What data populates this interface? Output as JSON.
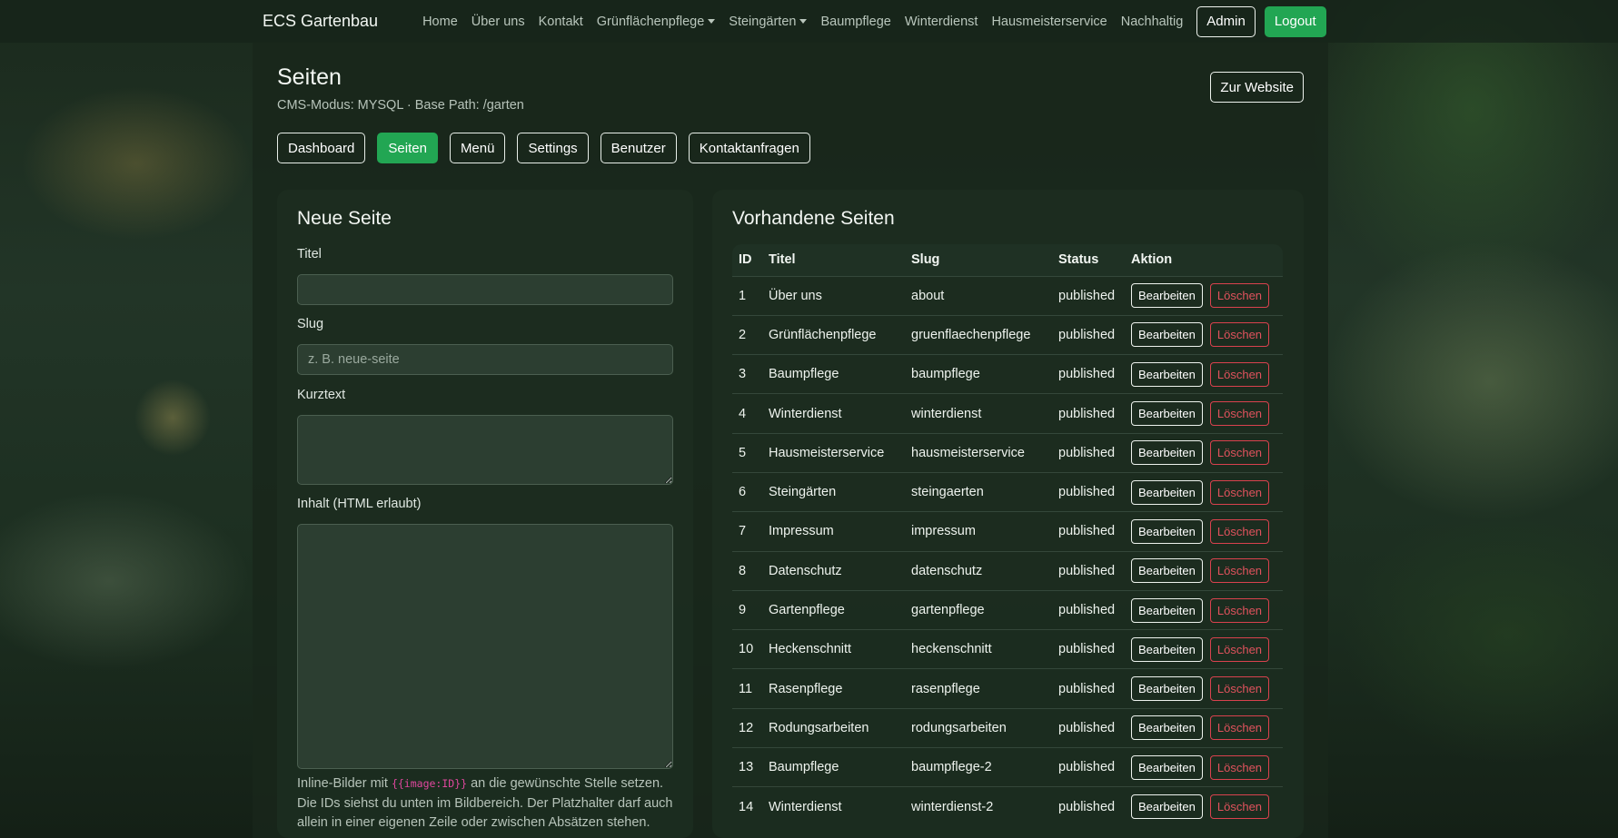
{
  "nav": {
    "brand": "ECS Gartenbau",
    "links": [
      {
        "label": "Home",
        "dropdown": false
      },
      {
        "label": "Über uns",
        "dropdown": false
      },
      {
        "label": "Kontakt",
        "dropdown": false
      },
      {
        "label": "Grünflächenpflege",
        "dropdown": true
      },
      {
        "label": "Steingärten",
        "dropdown": true
      },
      {
        "label": "Baumpflege",
        "dropdown": false
      },
      {
        "label": "Winterdienst",
        "dropdown": false
      },
      {
        "label": "Hausmeisterservice",
        "dropdown": false
      },
      {
        "label": "Nachhaltig",
        "dropdown": false
      }
    ],
    "admin_label": "Admin",
    "logout_label": "Logout"
  },
  "header": {
    "title": "Seiten",
    "subtitle": "CMS-Modus: MYSQL · Base Path: /garten",
    "to_site_label": "Zur Website"
  },
  "tabs": [
    {
      "label": "Dashboard",
      "active": false
    },
    {
      "label": "Seiten",
      "active": true
    },
    {
      "label": "Menü",
      "active": false
    },
    {
      "label": "Settings",
      "active": false
    },
    {
      "label": "Benutzer",
      "active": false
    },
    {
      "label": "Kontaktanfragen",
      "active": false
    }
  ],
  "new_page": {
    "heading": "Neue Seite",
    "title_label": "Titel",
    "title_value": "",
    "slug_label": "Slug",
    "slug_placeholder": "z. B. neue-seite",
    "short_label": "Kurztext",
    "content_label": "Inhalt (HTML erlaubt)",
    "help_pre": "Inline-Bilder mit",
    "help_code": "{{image:ID}}",
    "help_post": "an die gewünschte Stelle setzen. Die IDs siehst du unten im Bildbereich. Der Platzhalter darf auch allein in einer eigenen Zeile oder zwischen Absätzen stehen."
  },
  "pages": {
    "heading": "Vorhandene Seiten",
    "columns": [
      "ID",
      "Titel",
      "Slug",
      "Status",
      "Aktion"
    ],
    "edit_label": "Bearbeiten",
    "delete_label": "Löschen",
    "rows": [
      {
        "id": "1",
        "title": "Über uns",
        "slug": "about",
        "status": "published"
      },
      {
        "id": "2",
        "title": "Grünflächenpflege",
        "slug": "gruenflaechenpflege",
        "status": "published"
      },
      {
        "id": "3",
        "title": "Baumpflege",
        "slug": "baumpflege",
        "status": "published"
      },
      {
        "id": "4",
        "title": "Winterdienst",
        "slug": "winterdienst",
        "status": "published"
      },
      {
        "id": "5",
        "title": "Hausmeisterservice",
        "slug": "hausmeisterservice",
        "status": "published"
      },
      {
        "id": "6",
        "title": "Steingärten",
        "slug": "steingaerten",
        "status": "published"
      },
      {
        "id": "7",
        "title": "Impressum",
        "slug": "impressum",
        "status": "published"
      },
      {
        "id": "8",
        "title": "Datenschutz",
        "slug": "datenschutz",
        "status": "published"
      },
      {
        "id": "9",
        "title": "Gartenpflege",
        "slug": "gartenpflege",
        "status": "published"
      },
      {
        "id": "10",
        "title": "Heckenschnitt",
        "slug": "heckenschnitt",
        "status": "published"
      },
      {
        "id": "11",
        "title": "Rasenpflege",
        "slug": "rasenpflege",
        "status": "published"
      },
      {
        "id": "12",
        "title": "Rodungsarbeiten",
        "slug": "rodungsarbeiten",
        "status": "published"
      },
      {
        "id": "13",
        "title": "Baumpflege",
        "slug": "baumpflege-2",
        "status": "published"
      },
      {
        "id": "14",
        "title": "Winterdienst",
        "slug": "winterdienst-2",
        "status": "published"
      }
    ]
  }
}
